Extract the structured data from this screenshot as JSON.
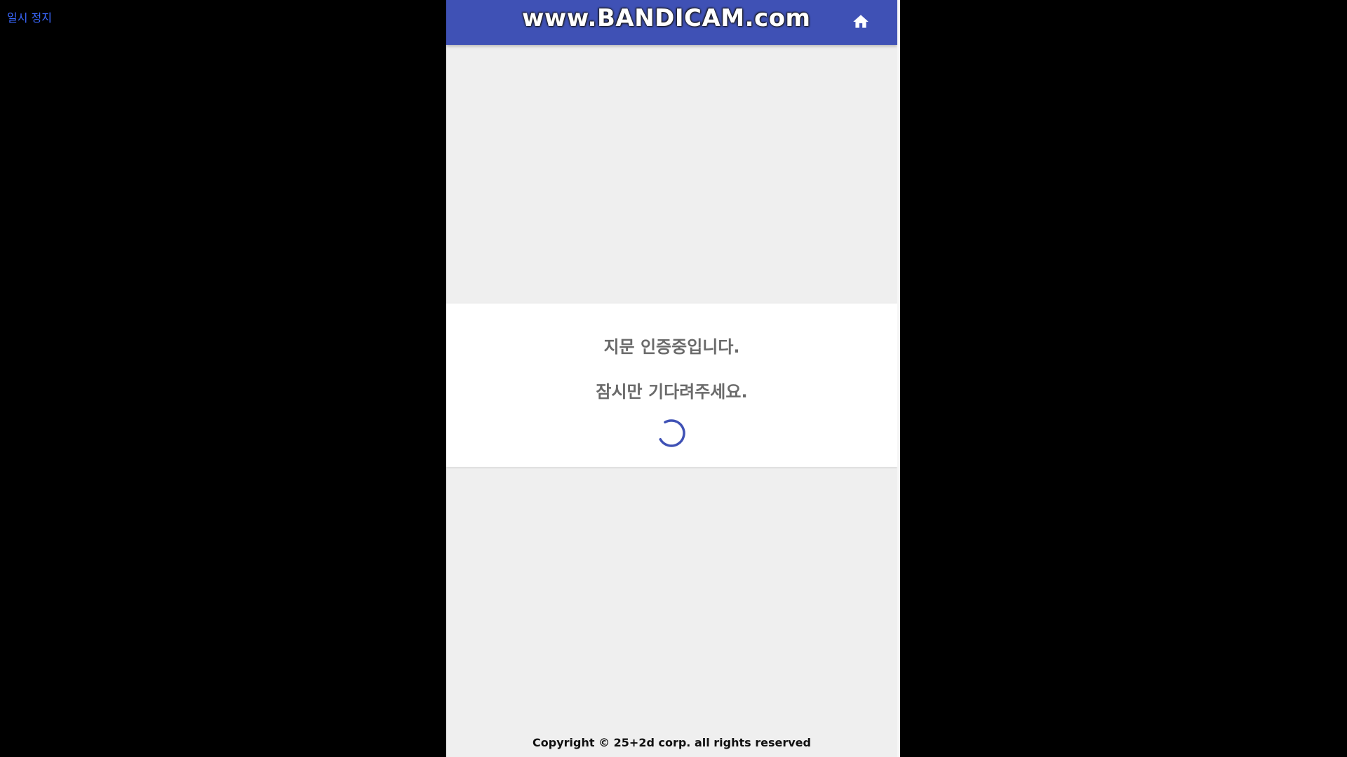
{
  "overlay": {
    "pause_label": "일시 정지"
  },
  "header": {
    "watermark_text": "www.BANDICAM.com",
    "home_icon": "home-icon",
    "background_color": "#3f51b5"
  },
  "auth_dialog": {
    "line1": "지문 인증중입니다.",
    "line2": "잠시만 기다려주세요.",
    "spinner_icon": "loading-spinner-icon",
    "spinner_color": "#3f51b5"
  },
  "footer": {
    "copyright": "Copyright © 25+2d corp. all rights reserved"
  }
}
